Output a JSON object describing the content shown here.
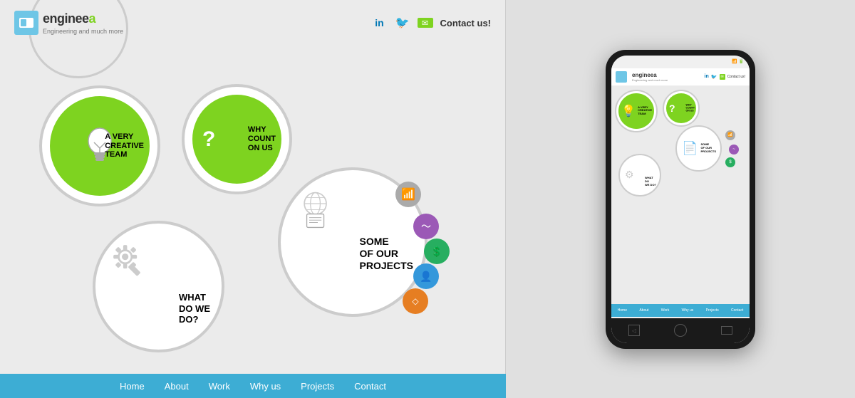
{
  "site": {
    "logo": {
      "name": "engineea",
      "name_highlight": "a",
      "tagline": "Engineering and much more"
    },
    "social": {
      "linkedin_label": "in",
      "twitter_label": "🐦",
      "contact_label": "Contact us!"
    },
    "nav": {
      "items": [
        "Home",
        "About",
        "Work",
        "Why us",
        "Projects",
        "Contact"
      ]
    }
  },
  "circles": {
    "creative_team": {
      "line1": "A VERY",
      "line2": "CREATIVE",
      "line3": "TEAM"
    },
    "why_count": {
      "line1": "WHY",
      "line2": "COUNT",
      "line3": "ON US"
    },
    "what_do": {
      "line1": "WHAT",
      "line2": "DO WE",
      "line3": "DO?"
    },
    "projects": {
      "line1": "SOME",
      "line2": "OF OUR",
      "line3": "PROJECTS"
    }
  },
  "phone": {
    "status": "📶🔋",
    "nav_items": [
      "Home",
      "About",
      "Work",
      "Why us",
      "Projects",
      "Contact"
    ],
    "what_do": {
      "line1": "WHAT",
      "line2": "DO",
      "line3": "WE DO?"
    }
  }
}
